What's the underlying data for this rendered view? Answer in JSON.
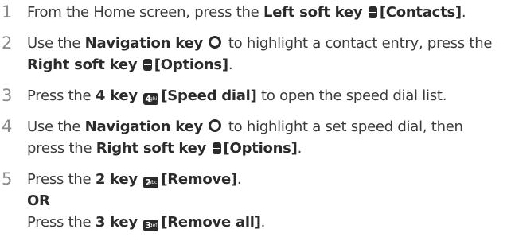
{
  "steps": [
    {
      "number": "1",
      "lines": [
        [
          "From the Home screen, press the ",
          "Left soft key",
          "[Contacts]",
          "."
        ]
      ]
    },
    {
      "number": "2",
      "line1": {
        "a": "Use the ",
        "b": "Navigation key",
        "c": " to highlight a contact entry, press the"
      },
      "line2": {
        "a": "Right soft key",
        "b": "[Options]",
        "c": "."
      }
    },
    {
      "number": "3",
      "a": "Press the ",
      "b": "4 key",
      "c": "[Speed dial]",
      "d": " to open the speed dial list."
    },
    {
      "number": "4",
      "line1": {
        "a": "Use the ",
        "b": "Navigation key",
        "c": " to highlight a set speed dial, then"
      },
      "line2": {
        "a": "press the ",
        "b": "Right soft key",
        "c": "[Options]",
        "d": "."
      }
    },
    {
      "number": "5",
      "line1": {
        "a": "Press the ",
        "b": "2 key",
        "c": "[Remove]",
        "d": "."
      },
      "or": "OR",
      "line3": {
        "a": "Press the ",
        "b": "3 key",
        "c": "[Remove all]",
        "d": "."
      }
    }
  ],
  "icons": {
    "soft_key": "soft-key-icon",
    "nav_key": "navigation-key-icon",
    "key4": {
      "digit": "4",
      "letters": "ghi"
    },
    "key2": {
      "digit": "2",
      "letters": "abc"
    },
    "key3": {
      "digit": "3",
      "letters": "def"
    }
  }
}
